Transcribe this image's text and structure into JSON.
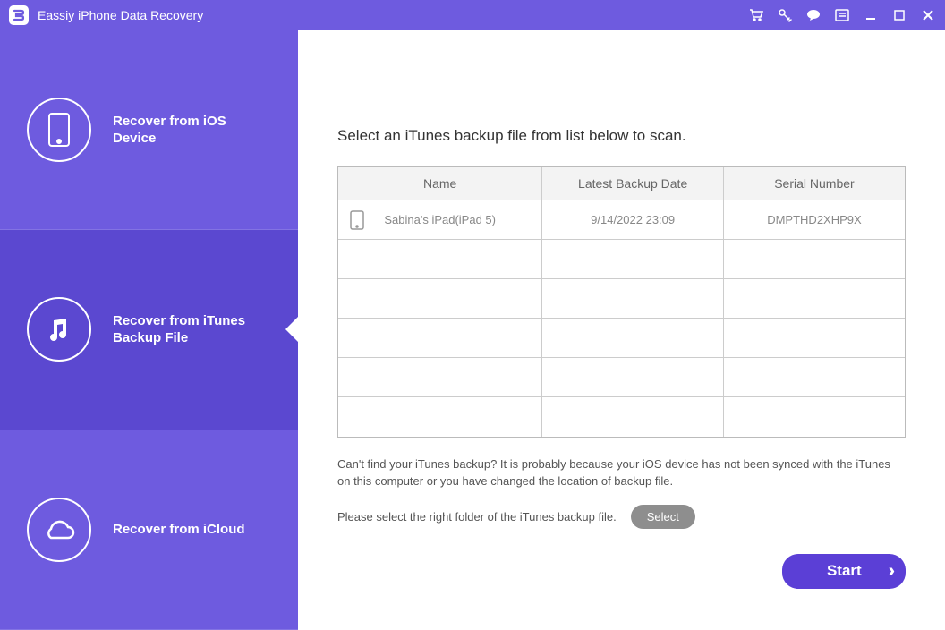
{
  "titlebar": {
    "logo_letter": "E",
    "title": "Eassiy iPhone Data Recovery"
  },
  "sidebar": {
    "items": [
      {
        "label": "Recover from iOS Device"
      },
      {
        "label": "Recover from iTunes Backup File"
      },
      {
        "label": "Recover from iCloud"
      }
    ]
  },
  "content": {
    "heading": "Select an iTunes backup file from list below to scan.",
    "table": {
      "headers": [
        "Name",
        "Latest Backup Date",
        "Serial Number"
      ],
      "rows": [
        {
          "name": "Sabina's iPad(iPad 5)",
          "date": "9/14/2022 23:09",
          "serial": "DMPTHD2XHP9X"
        }
      ]
    },
    "help1": "Can't find your iTunes backup? It is probably because your iOS device has not been synced with the iTunes on this computer or you have changed the location of backup file.",
    "help2": "Please select the right folder of the iTunes backup file.",
    "select_label": "Select",
    "start_label": "Start"
  }
}
